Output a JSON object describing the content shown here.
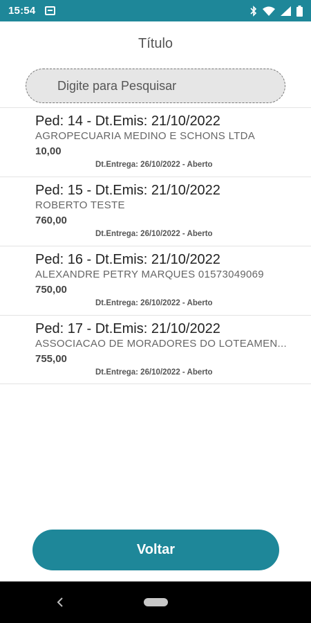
{
  "status_bar": {
    "time": "15:54",
    "icons": [
      "notification-icon",
      "bluetooth-icon",
      "wifi-icon",
      "signal-icon",
      "battery-icon"
    ]
  },
  "page": {
    "title": "Título"
  },
  "search": {
    "placeholder": "Digite para Pesquisar",
    "value": ""
  },
  "orders": [
    {
      "title": "Ped: 14 - Dt.Emis: 21/10/2022",
      "client": "AGROPECUARIA MEDINO E SCHONS LTDA",
      "value": "10,00",
      "delivery": "Dt.Entrega: 26/10/2022 - Aberto"
    },
    {
      "title": "Ped: 15 - Dt.Emis: 21/10/2022",
      "client": "ROBERTO TESTE",
      "value": "760,00",
      "delivery": "Dt.Entrega: 26/10/2022 - Aberto"
    },
    {
      "title": "Ped: 16 - Dt.Emis: 21/10/2022",
      "client": "ALEXANDRE PETRY MARQUES 01573049069",
      "value": "750,00",
      "delivery": "Dt.Entrega: 26/10/2022 - Aberto"
    },
    {
      "title": "Ped: 17 - Dt.Emis: 21/10/2022",
      "client": "ASSOCIACAO DE MORADORES DO LOTEAMEN...",
      "value": "755,00",
      "delivery": "Dt.Entrega: 26/10/2022 - Aberto"
    }
  ],
  "actions": {
    "back_label": "Voltar"
  },
  "colors": {
    "primary": "#1e8799",
    "nav_bar": "#000000"
  }
}
